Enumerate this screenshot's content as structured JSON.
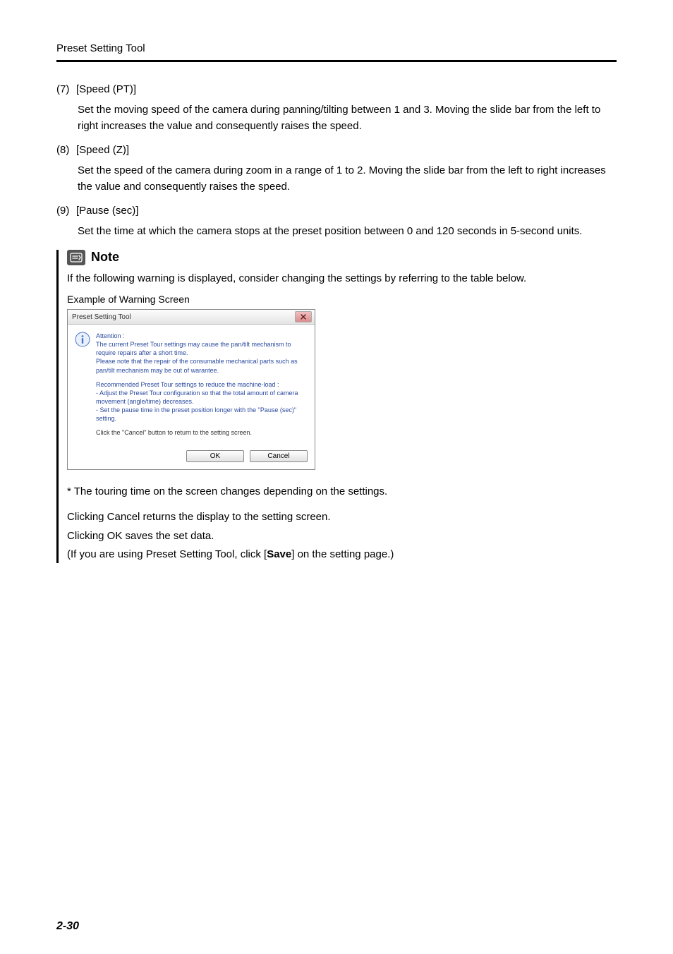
{
  "running_head": "Preset Setting Tool",
  "items": {
    "i7": {
      "num": "(7)",
      "label": "[Speed (PT)]",
      "para": "Set the moving speed of the camera during panning/tilting between 1 and 3. Moving the slide bar from the left to right increases the value and consequently raises the speed."
    },
    "i8": {
      "num": "(8)",
      "label": "[Speed (Z)]",
      "para": "Set the speed of the camera during zoom in a range of 1 to 2. Moving the slide bar from the left to right increases the value and consequently raises the speed."
    },
    "i9": {
      "num": "(9)",
      "label": "[Pause (sec)]",
      "para": "Set the time at which the camera stops at the preset position between 0 and 120 seconds in 5-second units."
    }
  },
  "note": {
    "title": "Note",
    "text": "If the following warning is displayed, consider changing the settings by referring to the table below.",
    "example_label": "Example of Warning Screen",
    "footnote": "* The touring time on the screen changes depending on the settings.",
    "line1": "Clicking Cancel returns the display to the setting screen.",
    "line2": "Clicking OK saves the set data.",
    "line3_a": "(If you are using Preset Setting Tool, click [",
    "line3_b": "Save",
    "line3_c": "] on the setting page.)"
  },
  "dialog": {
    "title": "Preset Setting Tool",
    "attention": "Attention :",
    "p1a": "  The current Preset Tour settings may cause the pan/tilt mechanism to require repairs after a short time.",
    "p1b": "  Please note that the repair of the consumable mechanical parts such as pan/tilt mechanism may be out of warantee.",
    "p2a": "Recommended Preset Tour settings to reduce the machine-load :",
    "p2b": "  - Adjust the Preset Tour configuration so that the total amount of camera movement (angle/time) decreases.",
    "p2c": "  - Set the pause time in the preset position longer with the \"Pause (sec)\" setting.",
    "p3": "Click the \"Cancel\" button to return to the setting screen.",
    "ok": "OK",
    "cancel": "Cancel"
  },
  "page_num": "2-30"
}
